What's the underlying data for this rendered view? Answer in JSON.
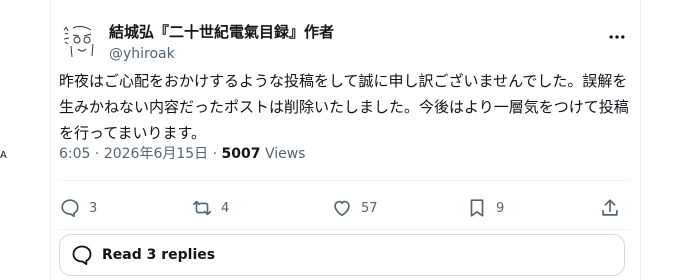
{
  "post": {
    "author": {
      "display_name": "結城弘『二十世紀電氣目録』作者",
      "handle": "@yhiroak"
    },
    "text": "昨夜はご心配をおかけするような投稿をして誠に申し訳ございませんでした。誤解を生みかねない内容だったポストは削除いたしました。今後はより一層気をつけて投稿を行ってまいります。",
    "time": "6:05",
    "date": "2026年6月15日",
    "views_count": "5007",
    "views_label": "Views"
  },
  "actions": {
    "replies": "3",
    "reposts": "4",
    "likes": "57",
    "bookmarks": "9"
  },
  "read_replies_label": "Read 3 replies",
  "edge_char": "A"
}
